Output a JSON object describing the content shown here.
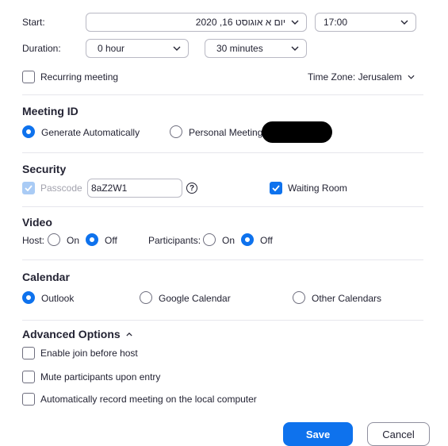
{
  "schedule": {
    "start_label": "Start:",
    "start_date": "יום א  אוגוסט  16, 2020",
    "start_time": "17:00",
    "duration_label": "Duration:",
    "duration_hours": "0 hour",
    "duration_minutes": "30 minutes",
    "recurring_label": "Recurring meeting",
    "timezone": "Time Zone: Jerusalem"
  },
  "meeting_id": {
    "title": "Meeting ID",
    "option_auto": "Generate Automatically",
    "option_personal": "Personal Meeting"
  },
  "security": {
    "title": "Security",
    "passcode_label": "Passcode",
    "passcode_value": "8aZ2W1",
    "help_glyph": "?",
    "waiting_room_label": "Waiting Room"
  },
  "video": {
    "title": "Video",
    "host_label": "Host:",
    "participants_label": "Participants:",
    "on_label": "On",
    "off_label": "Off"
  },
  "calendar": {
    "title": "Calendar",
    "options": [
      "Outlook",
      "Google Calendar",
      "Other Calendars"
    ]
  },
  "advanced": {
    "title": "Advanced Options",
    "options": [
      "Enable join before host",
      "Mute participants upon entry",
      "Automatically record meeting on the local computer"
    ]
  },
  "actions": {
    "save": "Save",
    "cancel": "Cancel"
  },
  "colors": {
    "accent": "#0e72ed",
    "text": "#232333",
    "border": "#b9b9c4"
  },
  "icons": {
    "dropdown": "chevron-down-icon",
    "collapse": "chevron-up-icon",
    "help": "help-icon",
    "check": "check-icon"
  }
}
